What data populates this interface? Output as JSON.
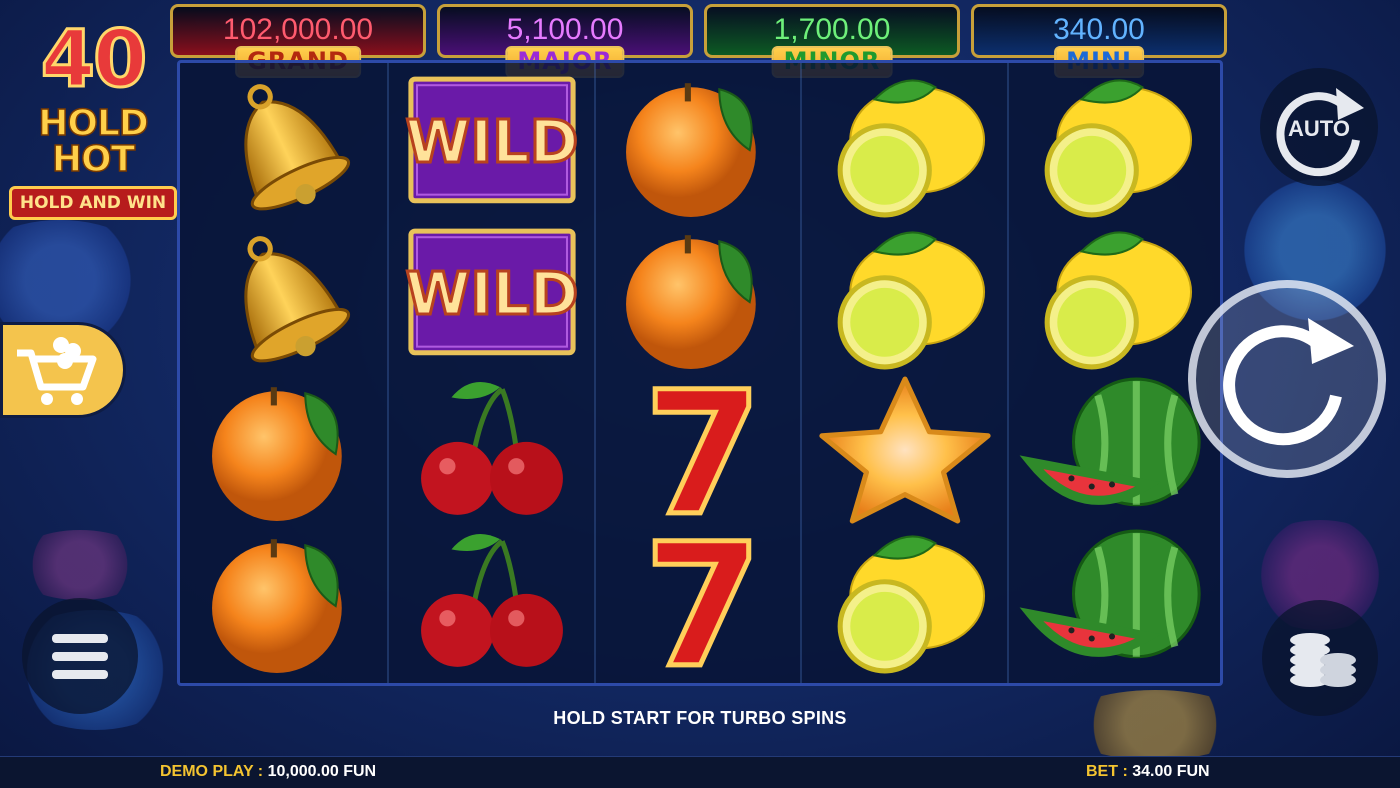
{
  "logo": {
    "number": "40",
    "title": "HOLD HOT",
    "subtitle": "HOLD AND WIN"
  },
  "jackpots": [
    {
      "value": "102,000.00",
      "label": "GRAND",
      "bg": "#8a0f1c",
      "value_color": "#ff5b6e",
      "label_bg": "#ffcf4d",
      "label_color": "#b3290f"
    },
    {
      "value": "5,100.00",
      "label": "MAJOR",
      "bg": "#4a0f76",
      "value_color": "#e67bff",
      "label_bg": "#ffcf4d",
      "label_color": "#9b2bd6"
    },
    {
      "value": "1,700.00",
      "label": "MINOR",
      "bg": "#0d5a23",
      "value_color": "#6ef07a",
      "label_bg": "#ffcf4d",
      "label_color": "#1f9a2e"
    },
    {
      "value": "340.00",
      "label": "MINI",
      "bg": "#0c2f6e",
      "value_color": "#62b3ff",
      "label_bg": "#ffcf4d",
      "label_color": "#1c6ad6"
    }
  ],
  "reels": [
    [
      "bell",
      "bell",
      "orange",
      "orange"
    ],
    [
      "wild",
      "wild",
      "cherry",
      "cherry"
    ],
    [
      "orange",
      "orange",
      "seven",
      "seven"
    ],
    [
      "lemon",
      "lemon",
      "star",
      "lemon"
    ],
    [
      "lemon",
      "lemon",
      "watermelon",
      "watermelon"
    ]
  ],
  "wild_text": "WILD",
  "buttons": {
    "auto": "AUTO",
    "spin_icon": "spin-icon",
    "shop_icon": "cart-icon",
    "menu_icon": "menu-icon",
    "bet_icon": "coins-icon"
  },
  "hint": "HOLD START FOR TURBO SPINS",
  "footer": {
    "demo_label": "DEMO PLAY :",
    "demo_value": "10,000.00 FUN",
    "bet_label": "BET :",
    "bet_value": "34.00 FUN"
  }
}
